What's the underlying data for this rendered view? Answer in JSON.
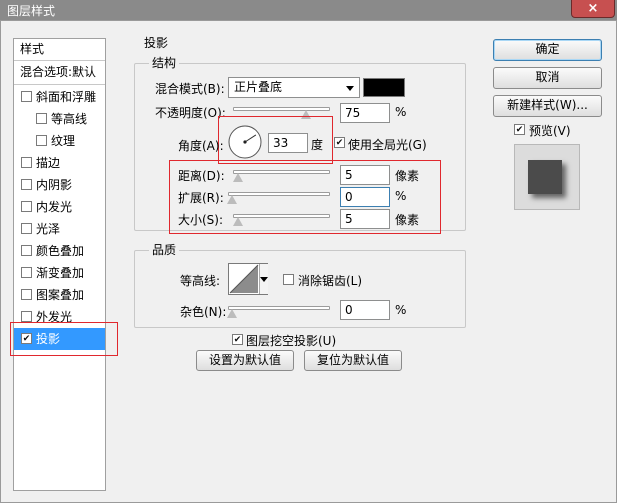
{
  "window": {
    "title": "图层样式",
    "close_glyph": "×"
  },
  "sidebar": {
    "header_style": "样式",
    "header_blend": "混合选项:默认",
    "items": [
      {
        "label": "斜面和浮雕",
        "checked": false,
        "indent": false
      },
      {
        "label": "等高线",
        "checked": false,
        "indent": true
      },
      {
        "label": "纹理",
        "checked": false,
        "indent": true
      },
      {
        "label": "描边",
        "checked": false,
        "indent": false
      },
      {
        "label": "内阴影",
        "checked": false,
        "indent": false
      },
      {
        "label": "内发光",
        "checked": false,
        "indent": false
      },
      {
        "label": "光泽",
        "checked": false,
        "indent": false
      },
      {
        "label": "颜色叠加",
        "checked": false,
        "indent": false
      },
      {
        "label": "渐变叠加",
        "checked": false,
        "indent": false
      },
      {
        "label": "图案叠加",
        "checked": false,
        "indent": false
      },
      {
        "label": "外发光",
        "checked": false,
        "indent": false
      },
      {
        "label": "投影",
        "checked": true,
        "indent": false,
        "selected": true
      }
    ]
  },
  "panel": {
    "title": "投影",
    "structure": {
      "title": "结构",
      "blend_mode_label": "混合模式(B):",
      "blend_mode_value": "正片叠底",
      "blend_color": "#000000",
      "opacity_label": "不透明度(O):",
      "opacity_value": "75",
      "opacity_unit": "%",
      "opacity_fraction": 0.75,
      "angle_label": "角度(A):",
      "angle_value": "33",
      "angle_unit": "度",
      "global_light_label": "使用全局光(G)",
      "global_light_checked": true,
      "distance_label": "距离(D):",
      "distance_value": "5",
      "distance_unit": "像素",
      "spread_label": "扩展(R):",
      "spread_value": "0",
      "spread_unit": "%",
      "size_label": "大小(S):",
      "size_value": "5",
      "size_unit": "像素"
    },
    "quality": {
      "title": "品质",
      "contour_label": "等高线:",
      "antialias_label": "消除锯齿(L)",
      "antialias_checked": false,
      "noise_label": "杂色(N):",
      "noise_value": "0",
      "noise_unit": "%"
    },
    "knockout_label": "图层挖空投影(U)",
    "knockout_checked": true,
    "make_default_label": "设置为默认值",
    "reset_default_label": "复位为默认值"
  },
  "actions": {
    "ok_label": "确定",
    "cancel_label": "取消",
    "new_style_label": "新建样式(W)...",
    "preview_label": "预览(V)",
    "preview_checked": true
  }
}
